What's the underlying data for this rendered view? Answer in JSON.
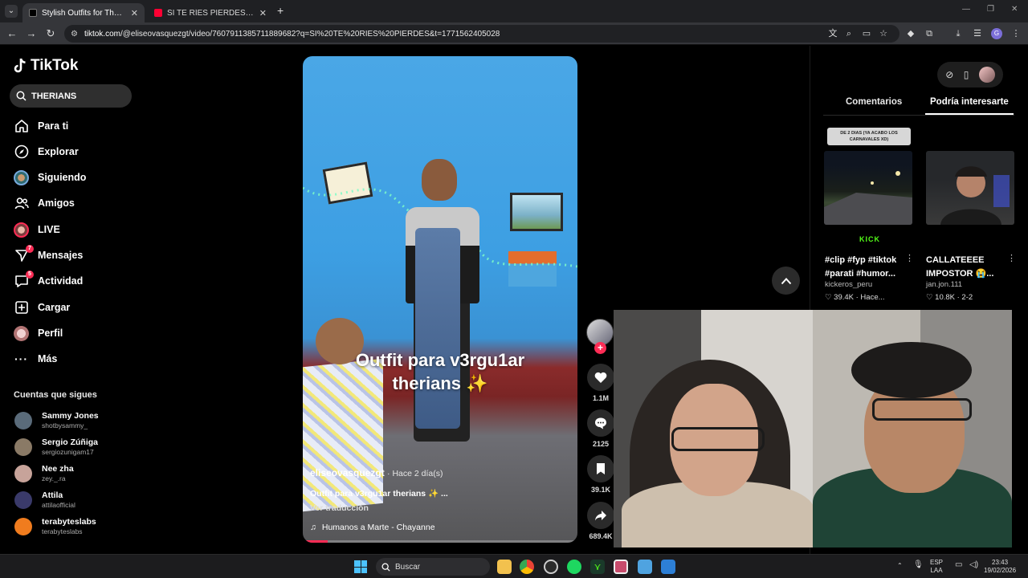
{
  "browser": {
    "tabs": [
      {
        "label": "Stylish Outfits for Therians: A G",
        "favicon_color": "#000000",
        "active": true
      },
      {
        "label": "SI TE RÍES PIERDES NIVEL DIOS",
        "favicon_color": "#ff0033",
        "active": false
      }
    ],
    "url_host": "tiktok.com",
    "url_path": "/@eliseovasquezgt/video/7607911385711889682?q=SI%20TE%20RIES%20PIERDES&t=1771562405028"
  },
  "sidebar": {
    "logo_text": "TikTok",
    "search_value": "THERIANS",
    "nav": [
      {
        "label": "Para ti",
        "icon": "home-icon"
      },
      {
        "label": "Explorar",
        "icon": "compass-icon"
      },
      {
        "label": "Siguiendo",
        "icon": "following-avatar"
      },
      {
        "label": "Amigos",
        "icon": "friends-icon"
      },
      {
        "label": "LIVE",
        "icon": "live-avatar"
      },
      {
        "label": "Mensajes",
        "icon": "messages-icon",
        "badge": "7"
      },
      {
        "label": "Actividad",
        "icon": "activity-icon",
        "badge": "5"
      },
      {
        "label": "Cargar",
        "icon": "upload-icon"
      },
      {
        "label": "Perfil",
        "icon": "profile-avatar"
      },
      {
        "label": "Más",
        "icon": "more-icon"
      }
    ],
    "following_title": "Cuentas que sigues",
    "accounts": [
      {
        "name": "Sammy Jones",
        "handle": "shotbysammy_",
        "color": "#5a6b7a"
      },
      {
        "name": "Sergio Zúñiga",
        "handle": "sergiozunigam17",
        "color": "#8a7a66"
      },
      {
        "name": "Nee zha",
        "handle": "zey._.ra",
        "color": "#c7a39a"
      },
      {
        "name": "Attila",
        "handle": "attilaofficial",
        "color": "#3a3a6a"
      },
      {
        "name": "terabyteslabs",
        "handle": "terabyteslabs",
        "color": "#f07c1e"
      }
    ]
  },
  "video": {
    "overlay_title_line1": "Outfit para v3rgu1ar",
    "overlay_title_line2": "therians ✨",
    "author": "eliseovasquezgt",
    "ago": "· Hace 2 día(s)",
    "description": "Outfit para v3rgu1ar therians ✨ ...",
    "translate": "Ver traducción",
    "music": "Humanos a Marte - Chayanne",
    "progress_percent": 9
  },
  "actions": {
    "likes": "1.1M",
    "comments": "2125",
    "saves": "39.1K",
    "shares": "689.4K"
  },
  "rightpanel": {
    "tab_comments": "Comentarios",
    "tab_interest": "Podría interesarte",
    "caption_chip": "DE 2 DIAS (YA ACABO LOS CARNAVALES XD)",
    "kick_label": "KICK",
    "cards": [
      {
        "title": "#clip #fyp #tiktok #parati #humor...",
        "author": "kickeros_peru",
        "stats": "39.4K · Hace..."
      },
      {
        "title": "CALLATEEEE IMPOSTOR 😭...",
        "author": "jan.jon.111",
        "stats": "10.8K · 2-2"
      }
    ]
  },
  "taskbar": {
    "search_label": "Buscar",
    "lang_top": "ESP",
    "lang_bottom": "LAA",
    "time": "23:43",
    "date": "19/02/2026"
  }
}
